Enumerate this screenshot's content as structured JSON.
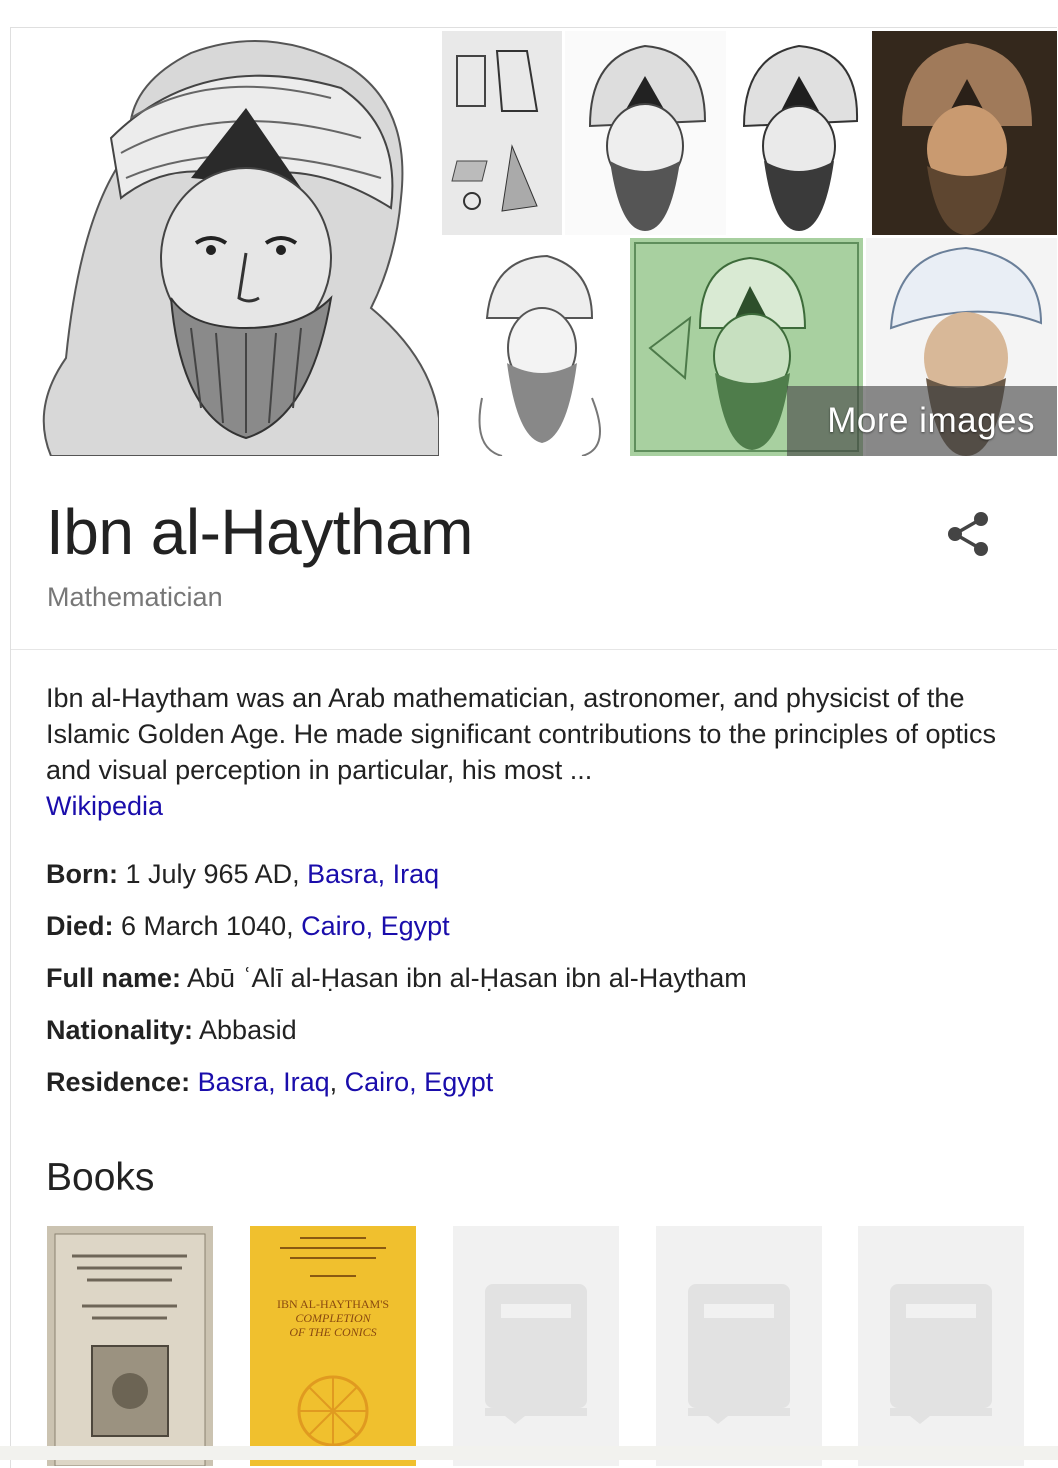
{
  "images": {
    "more_images_label": "More images",
    "items": [
      {
        "name": "main-portrait-image",
        "kind": "portrait-engraving"
      },
      {
        "name": "camera-obscura-diagram-image",
        "kind": "diagram"
      },
      {
        "name": "portrait-thumbnail-2",
        "kind": "portrait-engraving"
      },
      {
        "name": "portrait-thumbnail-3",
        "kind": "portrait-engraving"
      },
      {
        "name": "color-portrait-thumbnail",
        "kind": "portrait-color"
      },
      {
        "name": "sketch-portrait-thumbnail",
        "kind": "sketch"
      },
      {
        "name": "banknote-thumbnail",
        "kind": "banknote"
      },
      {
        "name": "turban-portrait-thumbnail",
        "kind": "portrait-color"
      }
    ]
  },
  "entity": {
    "name": "Ibn al-Haytham",
    "type": "Mathematician",
    "share_icon": "share-icon"
  },
  "description": {
    "text": "Ibn al-Haytham was an Arab mathematician, astronomer, and physicist of the Islamic Golden Age. He made significant contributions to the principles of optics and visual perception in particular, his most ...",
    "source": "Wikipedia"
  },
  "facts": {
    "born": {
      "label": "Born:",
      "text": " 1 July 965 AD, ",
      "link": "Basra, Iraq"
    },
    "died": {
      "label": "Died:",
      "text": " 6 March 1040, ",
      "link": "Cairo, Egypt"
    },
    "full_name": {
      "label": "Full name:",
      "text": " Abū ʿAlī al-Ḥasan ibn al-Ḥasan ibn al-Haytham"
    },
    "nationality": {
      "label": "Nationality:",
      "text": " Abbasid"
    },
    "residence": {
      "label": "Residence:",
      "link1": "Basra, Iraq",
      "sep": ", ",
      "link2": "Cairo, Egypt"
    }
  },
  "books": {
    "title": "Books",
    "items": [
      {
        "kind": "old-latin-cover",
        "cover_color": "#cfc8b8"
      },
      {
        "kind": "yellow-cover",
        "cover_color": "#f2c12e",
        "cover_lines": [
          "IBN AL-HAYTHAM'S",
          "COMPLETION",
          "OF THE CONICS"
        ]
      },
      {
        "kind": "placeholder"
      },
      {
        "kind": "placeholder"
      },
      {
        "kind": "placeholder"
      }
    ]
  },
  "colors": {
    "link": "#1a0dab",
    "title": "#222222",
    "subtitle": "#777777",
    "share_icon": "#444444"
  }
}
